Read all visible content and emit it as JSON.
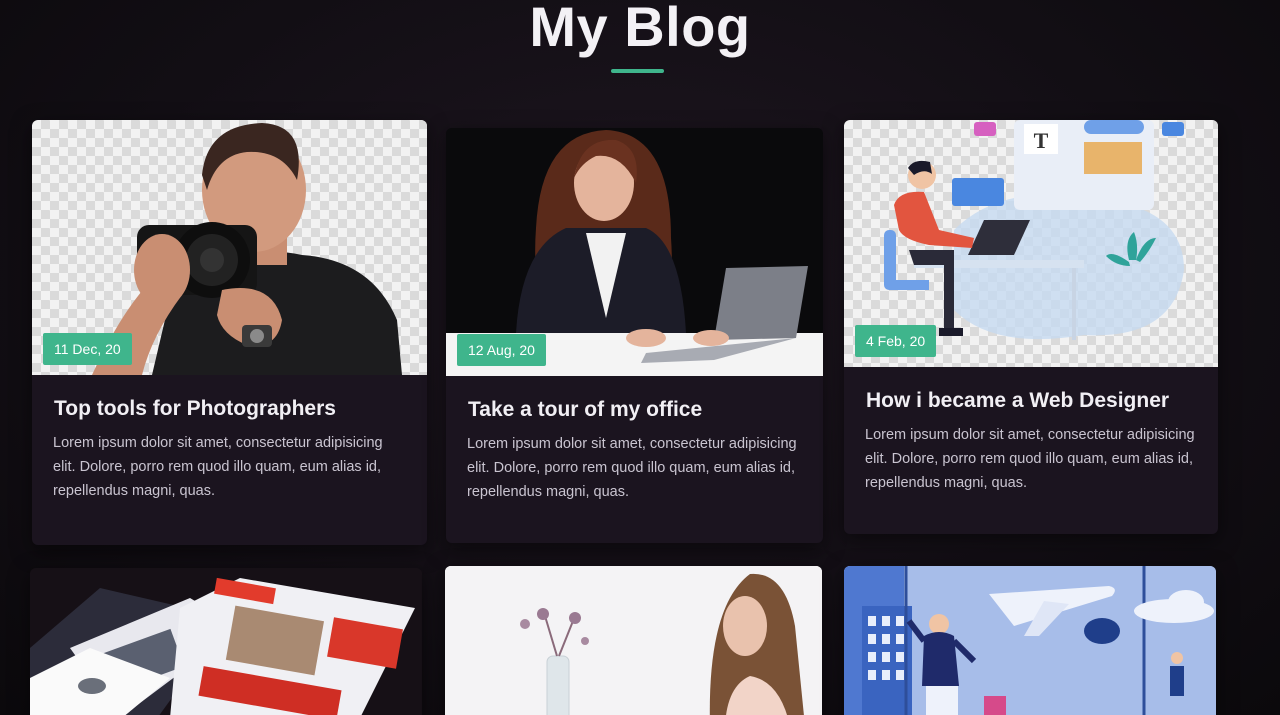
{
  "header": {
    "title": "My Blog"
  },
  "colors": {
    "accent": "#3fb58c",
    "card_bg": "#1b141f",
    "page_bg": "#120e14"
  },
  "posts": [
    {
      "date": "11 Dec, 20",
      "title": "Top tools for Photographers",
      "excerpt": "Lorem ipsum dolor sit amet, consectetur adipisicing elit. Dolore, porro rem quod illo quam, eum alias id, repellendus magni, quas.",
      "image": "photographer-with-camera"
    },
    {
      "date": "12 Aug, 20",
      "title": "Take a tour of my office",
      "excerpt": "Lorem ipsum dolor sit amet, consectetur adipisicing elit. Dolore, porro rem quod illo quam, eum alias id, repellendus magni, quas.",
      "image": "woman-at-laptop"
    },
    {
      "date": "4 Feb, 20",
      "title": "How i became a Web Designer",
      "excerpt": "Lorem ipsum dolor sit amet, consectetur adipisicing elit. Dolore, porro rem quod illo quam, eum alias id, repellendus magni, quas.",
      "image": "web-designer-illustration"
    },
    {
      "image": "magazine-flyers"
    },
    {
      "image": "woman-with-vase"
    },
    {
      "image": "city-travel-illustration"
    }
  ]
}
